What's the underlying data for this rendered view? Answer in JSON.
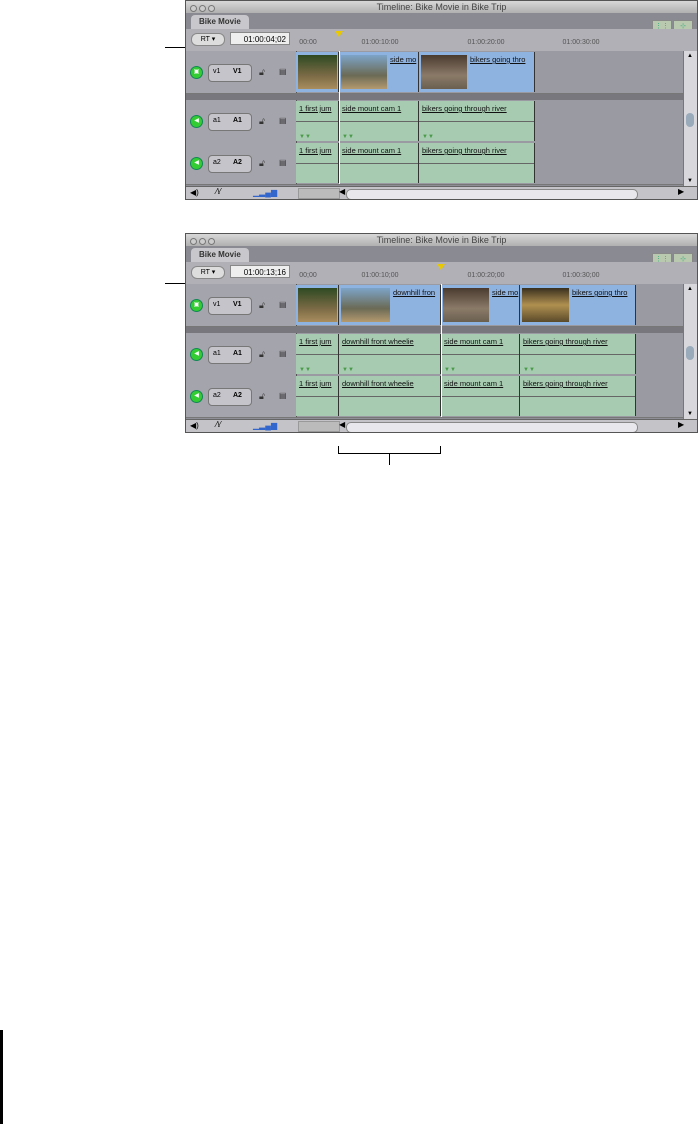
{
  "timelines": [
    {
      "window_title": "Timeline: Bike Movie in Bike Trip",
      "tab": "Bike Movie",
      "rt_button": "RT ▾",
      "timecode": "01:00:04;02",
      "ruler_ticks": [
        "00:00",
        "01:00:10:00",
        "01:00:20:00",
        "01:00:30:00"
      ],
      "video_track": {
        "source": "v1",
        "dest": "V1",
        "clips": [
          "",
          "side mo",
          "bikers going thro"
        ]
      },
      "audio_tracks": [
        {
          "source": "a1",
          "dest": "A1",
          "clips": [
            "1 first jum",
            "side mount cam 1",
            "bikers going through river"
          ]
        },
        {
          "source": "a2",
          "dest": "A2",
          "clips": [
            "1 first jum",
            "side mount cam 1",
            "bikers going through river"
          ]
        }
      ]
    },
    {
      "window_title": "Timeline: Bike Movie in Bike Trip",
      "tab": "Bike Movie",
      "rt_button": "RT ▾",
      "timecode": "01:00:13;16",
      "ruler_ticks": [
        "00;00",
        "01:00:10;00",
        "01:00:20;00",
        "01:00:30;00"
      ],
      "video_track": {
        "source": "v1",
        "dest": "V1",
        "clips": [
          "",
          "downhill fron",
          "side mo",
          "bikers going thro"
        ]
      },
      "audio_tracks": [
        {
          "source": "a1",
          "dest": "A1",
          "clips": [
            "1 first jum",
            "downhill front wheelie",
            "side mount cam 1",
            "bikers going through river"
          ]
        },
        {
          "source": "a2",
          "dest": "A2",
          "clips": [
            "1 first jum",
            "downhill front wheelie",
            "side mount cam 1",
            "bikers going through river"
          ]
        }
      ]
    }
  ],
  "colors": {
    "video_clip": "#8fb3e0",
    "audio_clip": "#a6cbb0",
    "playhead": "#e8c800"
  }
}
